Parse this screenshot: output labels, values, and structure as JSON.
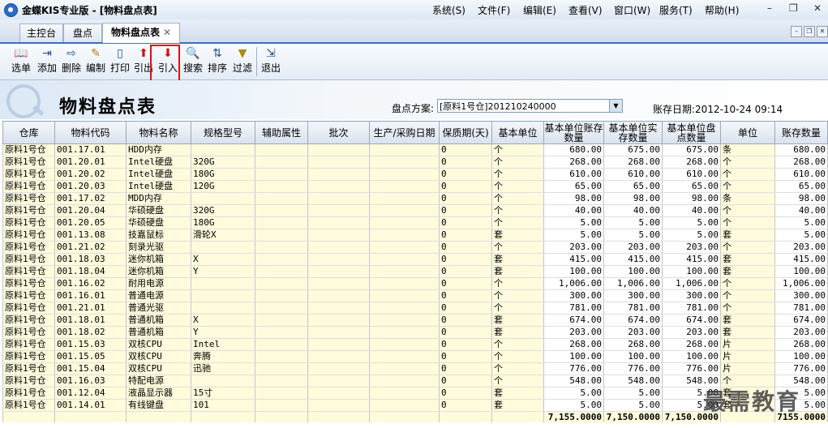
{
  "window": {
    "title": "金蝶KIS专业版 - [物料盘点表]",
    "menus": [
      "系统(S)",
      "文件(F)",
      "编辑(E)",
      "查看(V)",
      "窗口(W)",
      "服务(T)",
      "帮助(H)"
    ]
  },
  "tabs": [
    {
      "label": "主控台"
    },
    {
      "label": "盘点"
    },
    {
      "label": "物料盘点表",
      "close": "✕"
    }
  ],
  "toolbar": {
    "buttons": [
      {
        "label": "选单",
        "icon": "book-icon"
      },
      {
        "label": "添加",
        "icon": "add-icon"
      },
      {
        "label": "删除",
        "icon": "delete-icon"
      },
      {
        "label": "编制",
        "icon": "edit-icon"
      },
      {
        "label": "打印",
        "icon": "print-icon"
      },
      {
        "label": "引出",
        "icon": "export-icon"
      },
      {
        "label": "引入",
        "icon": "import-icon"
      },
      {
        "label": "搜索",
        "icon": "search-icon"
      },
      {
        "label": "排序",
        "icon": "sort-icon"
      },
      {
        "label": "过滤",
        "icon": "filter-icon"
      },
      {
        "label": "退出",
        "icon": "exit-icon"
      }
    ]
  },
  "header": {
    "title": "物料盘点表",
    "plan_label": "盘点方案:",
    "plan_value": "[原料1号仓]201210240000",
    "account_date": "账存日期:2012-10-24 09:14"
  },
  "table": {
    "columns": [
      "仓库",
      "物料代码",
      "物料名称",
      "规格型号",
      "辅助属性",
      "批次",
      "生产/采购日期",
      "保质期(天)",
      "基本单位",
      "基本单位账存数量",
      "基本单位实存数量",
      "基本单位盘点数量",
      "单位",
      "账存数量"
    ],
    "rows": [
      [
        "原料1号仓",
        "001.17.01",
        "HDD内存",
        "",
        "",
        "",
        "",
        "0",
        "个",
        "680.00",
        "675.00",
        "675.00",
        "条",
        "680.00"
      ],
      [
        "原料1号仓",
        "001.20.01",
        "Intel硬盘",
        "320G",
        "",
        "",
        "",
        "0",
        "个",
        "268.00",
        "268.00",
        "268.00",
        "个",
        "268.00"
      ],
      [
        "原料1号仓",
        "001.20.02",
        "Intel硬盘",
        "180G",
        "",
        "",
        "",
        "0",
        "个",
        "610.00",
        "610.00",
        "610.00",
        "个",
        "610.00"
      ],
      [
        "原料1号仓",
        "001.20.03",
        "Intel硬盘",
        "120G",
        "",
        "",
        "",
        "0",
        "个",
        "65.00",
        "65.00",
        "65.00",
        "个",
        "65.00"
      ],
      [
        "原料1号仓",
        "001.17.02",
        "MDD内存",
        "",
        "",
        "",
        "",
        "0",
        "个",
        "98.00",
        "98.00",
        "98.00",
        "条",
        "98.00"
      ],
      [
        "原料1号仓",
        "001.20.04",
        "华硕硬盘",
        "320G",
        "",
        "",
        "",
        "0",
        "个",
        "40.00",
        "40.00",
        "40.00",
        "个",
        "40.00"
      ],
      [
        "原料1号仓",
        "001.20.05",
        "华硕硬盘",
        "180G",
        "",
        "",
        "",
        "0",
        "个",
        "5.00",
        "5.00",
        "5.00",
        "个",
        "5.00"
      ],
      [
        "原料1号仓",
        "001.13.08",
        "技嘉鼠标",
        "滑轮X",
        "",
        "",
        "",
        "0",
        "套",
        "5.00",
        "5.00",
        "5.00",
        "套",
        "5.00"
      ],
      [
        "原料1号仓",
        "001.21.02",
        "刻录光驱",
        "",
        "",
        "",
        "",
        "0",
        "个",
        "203.00",
        "203.00",
        "203.00",
        "个",
        "203.00"
      ],
      [
        "原料1号仓",
        "001.18.03",
        "迷你机箱",
        "X",
        "",
        "",
        "",
        "0",
        "套",
        "415.00",
        "415.00",
        "415.00",
        "套",
        "415.00"
      ],
      [
        "原料1号仓",
        "001.18.04",
        "迷你机箱",
        "Y",
        "",
        "",
        "",
        "0",
        "套",
        "100.00",
        "100.00",
        "100.00",
        "套",
        "100.00"
      ],
      [
        "原料1号仓",
        "001.16.02",
        "耐用电源",
        "",
        "",
        "",
        "",
        "0",
        "个",
        "1,006.00",
        "1,006.00",
        "1,006.00",
        "个",
        "1,006.00"
      ],
      [
        "原料1号仓",
        "001.16.01",
        "普通电源",
        "",
        "",
        "",
        "",
        "0",
        "个",
        "300.00",
        "300.00",
        "300.00",
        "个",
        "300.00"
      ],
      [
        "原料1号仓",
        "001.21.01",
        "普通光驱",
        "",
        "",
        "",
        "",
        "0",
        "个",
        "781.00",
        "781.00",
        "781.00",
        "个",
        "781.00"
      ],
      [
        "原料1号仓",
        "001.18.01",
        "普通机箱",
        "X",
        "",
        "",
        "",
        "0",
        "套",
        "674.00",
        "674.00",
        "674.00",
        "套",
        "674.00"
      ],
      [
        "原料1号仓",
        "001.18.02",
        "普通机箱",
        "Y",
        "",
        "",
        "",
        "0",
        "套",
        "203.00",
        "203.00",
        "203.00",
        "套",
        "203.00"
      ],
      [
        "原料1号仓",
        "001.15.03",
        "双核CPU",
        "Intel",
        "",
        "",
        "",
        "0",
        "个",
        "268.00",
        "268.00",
        "268.00",
        "片",
        "268.00"
      ],
      [
        "原料1号仓",
        "001.15.05",
        "双核CPU",
        "奔腾",
        "",
        "",
        "",
        "0",
        "个",
        "100.00",
        "100.00",
        "100.00",
        "片",
        "100.00"
      ],
      [
        "原料1号仓",
        "001.15.04",
        "双核CPU",
        "迅驰",
        "",
        "",
        "",
        "0",
        "个",
        "776.00",
        "776.00",
        "776.00",
        "片",
        "776.00"
      ],
      [
        "原料1号仓",
        "001.16.03",
        "特配电源",
        "",
        "",
        "",
        "",
        "0",
        "个",
        "548.00",
        "548.00",
        "548.00",
        "个",
        "548.00"
      ],
      [
        "原料1号仓",
        "001.12.04",
        "液晶显示器",
        "15寸",
        "",
        "",
        "",
        "0",
        "套",
        "5.00",
        "5.00",
        "5.00",
        "套",
        "5.00"
      ],
      [
        "原料1号仓",
        "001.14.01",
        "有线键盘",
        "101",
        "",
        "",
        "",
        "0",
        "套",
        "5.00",
        "5.00",
        "5.00",
        "套",
        "5.00"
      ]
    ],
    "totals": [
      "",
      "",
      "",
      "",
      "",
      "",
      "",
      "",
      "",
      "7,155.0000",
      "7,150.0000",
      "7,150.0000",
      "",
      "7155.0000"
    ]
  },
  "watermark": "最需教育",
  "colors": {
    "highlight": "#e01010",
    "grid_yellow": "#fffbdc",
    "tab_accent": "#3d6fb8"
  }
}
